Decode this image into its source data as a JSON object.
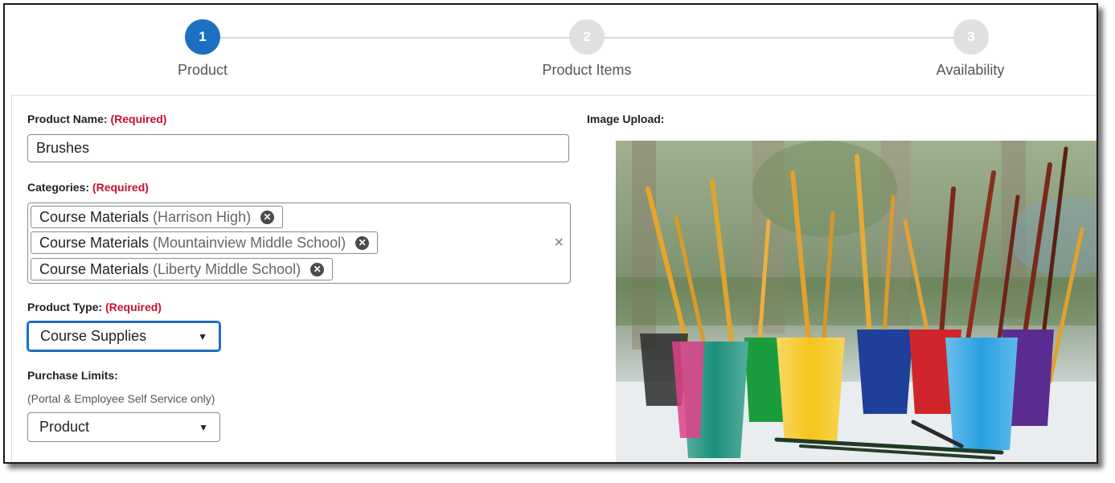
{
  "stepper": {
    "steps": [
      {
        "number": "1",
        "label": "Product",
        "active": true
      },
      {
        "number": "2",
        "label": "Product Items",
        "active": false
      },
      {
        "number": "3",
        "label": "Availability",
        "active": false
      }
    ]
  },
  "form": {
    "product_name": {
      "label": "Product Name:",
      "required": "(Required)",
      "value": "Brushes"
    },
    "categories": {
      "label": "Categories:",
      "required": "(Required)",
      "chips": [
        {
          "name": "Course Materials",
          "detail": "(Harrison High)"
        },
        {
          "name": "Course Materials",
          "detail": "(Mountainview Middle School)"
        },
        {
          "name": "Course Materials",
          "detail": "(Liberty Middle School)"
        }
      ],
      "clear_icon": "×"
    },
    "product_type": {
      "label": "Product Type:",
      "required": "(Required)",
      "value": "Course Supplies"
    },
    "purchase_limits": {
      "label": "Purchase Limits:",
      "hint": "(Portal & Employee Self Service only)",
      "value": "Product"
    },
    "image_upload": {
      "label": "Image Upload:"
    }
  },
  "colors": {
    "accent": "#1c6fc1",
    "required": "#c8102e",
    "inactive_step": "#e0e0e0"
  }
}
